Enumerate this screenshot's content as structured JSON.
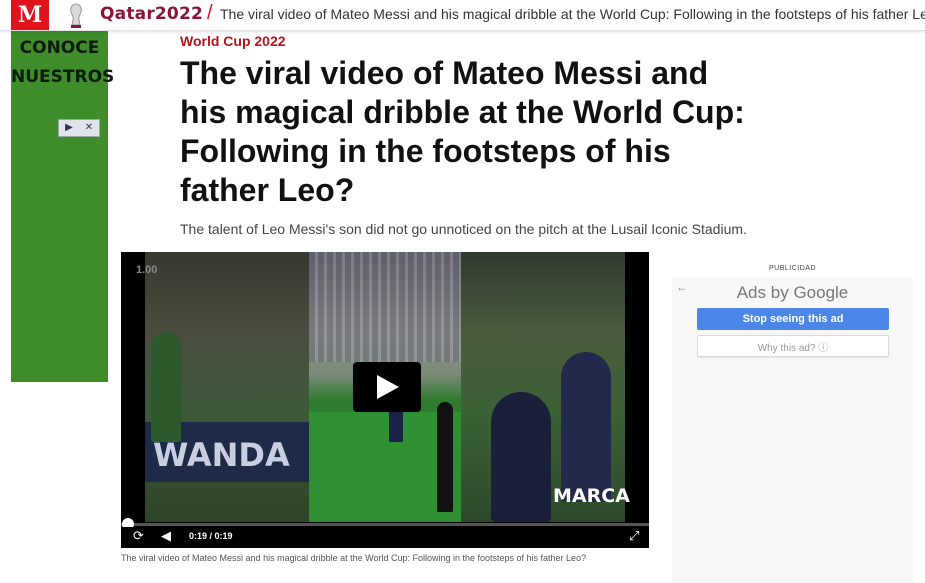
{
  "header": {
    "logo": "M",
    "event": "Qatar2022",
    "breadcrumb_title": "The viral video of Mateo Messi and his magical dribble at the World Cup: Following in the footsteps of his father Leo?"
  },
  "left_ad": {
    "text_line1": "CONOCE",
    "text_line2": "NUESTROS",
    "play_symbol": "▶",
    "close_symbol": "✕"
  },
  "article": {
    "section": "World Cup 2022",
    "headline": "The viral video of Mateo Messi and his magical dribble at the World Cup: Following in the footsteps of his father Leo?",
    "subtitle": "The talent of Leo Messi's son did not go unnoticed on the pitch at the Lusail Iconic Stadium."
  },
  "video": {
    "playback_rate": "1.00",
    "banner_text": "WANDA",
    "watermark": "MARCA",
    "time": "0:19 / 0:19",
    "progress": 0.0,
    "caption": "The viral video of Mateo Messi and his magical dribble at the World Cup: Following in the footsteps of his father Leo?"
  },
  "ad_panel": {
    "label": "PUBLICIDAD",
    "ads_by": "Ads by",
    "google": "Google",
    "stop_button": "Stop seeing this ad",
    "why_button": "Why this ad? ⓘ",
    "back_symbol": "←"
  },
  "colors": {
    "brand_red": "#e0121a",
    "qatar_maroon": "#8a1538",
    "ad_green": "#3f8d2a",
    "button_blue": "#4a87e8"
  }
}
